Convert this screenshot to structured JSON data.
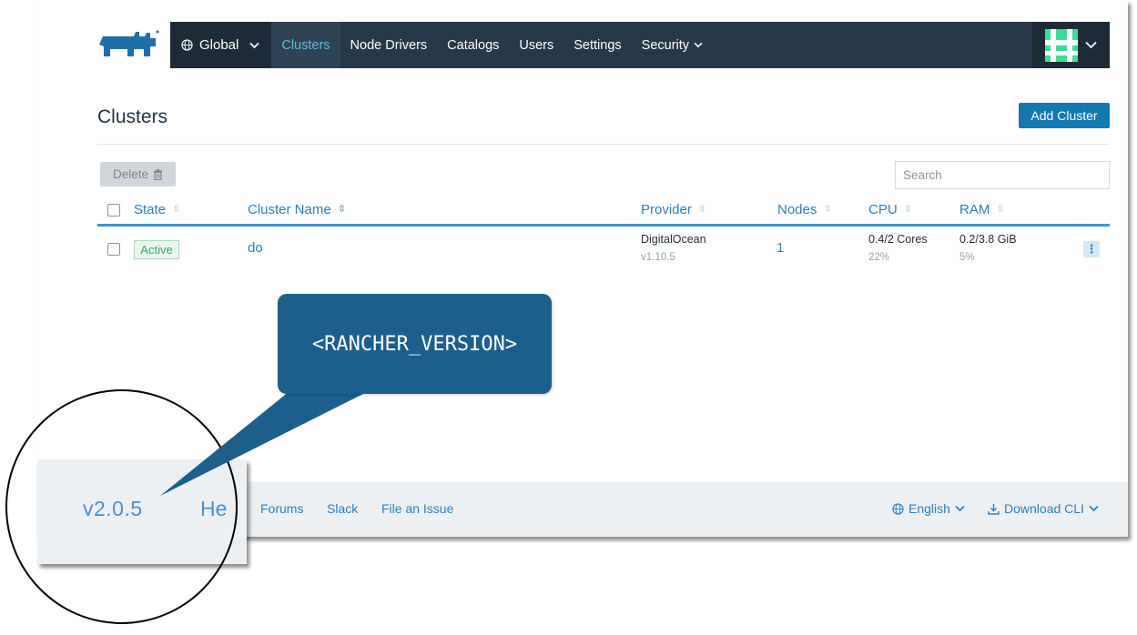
{
  "nav": {
    "global_label": "Global",
    "items": [
      "Clusters",
      "Node Drivers",
      "Catalogs",
      "Users",
      "Settings",
      "Security"
    ]
  },
  "page": {
    "title": "Clusters",
    "add_button": "Add Cluster",
    "delete_button": "Delete",
    "search_placeholder": "Search"
  },
  "table": {
    "headers": [
      "State",
      "Cluster Name",
      "Provider",
      "Nodes",
      "CPU",
      "RAM"
    ],
    "rows": [
      {
        "state": "Active",
        "name": "do",
        "provider": "DigitalOcean",
        "provider_version": "v1.10.5",
        "nodes": "1",
        "cpu": "0.4/2 Cores",
        "cpu_pct": "22%",
        "ram": "0.2/3.8 GiB",
        "ram_pct": "5%"
      }
    ]
  },
  "footer": {
    "version": "v2.0.5",
    "help_partial": "He",
    "links": [
      "Forums",
      "Slack",
      "File an Issue"
    ],
    "language": "English",
    "download": "Download CLI"
  },
  "callout": {
    "text": "<RANCHER_VERSION>"
  },
  "colors": {
    "nav_bg": "#27384a",
    "accent": "#1478b3",
    "link": "#2c7fbf",
    "callout_bg": "#1c5f8d",
    "avatar": "#3ddc97"
  }
}
